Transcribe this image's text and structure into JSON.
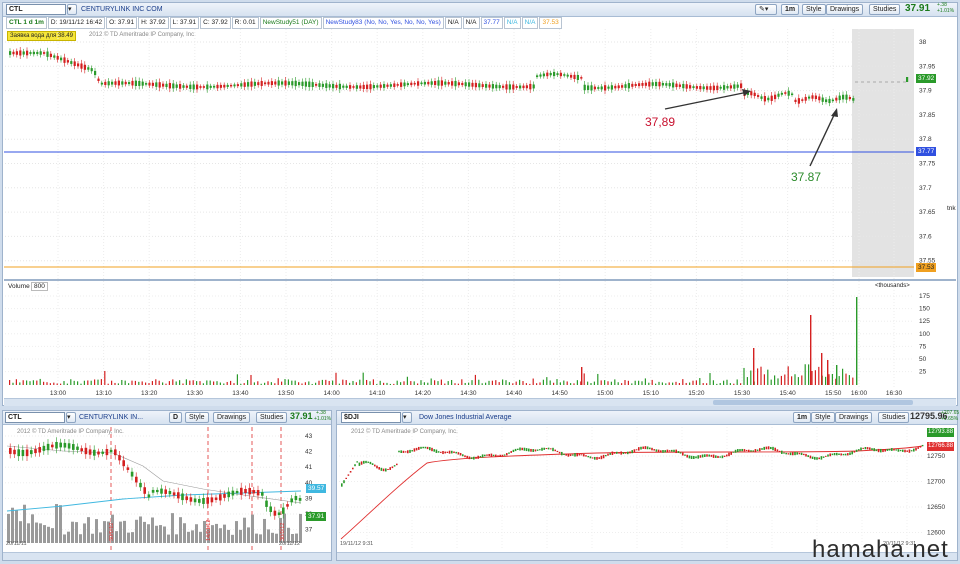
{
  "main_window": {
    "symbol": "CTL",
    "description": "CENTURYLINK INC COM",
    "toolbar": {
      "zoom": "1m",
      "style": "Style",
      "drawings": "Drawings",
      "studies": "Studies"
    },
    "last_price": "37.91",
    "change_line1": "+.38",
    "change_line2": "+1.01%",
    "info_chips": [
      "CTL 1 d 1m",
      "D: 19/11/12 16:42",
      "O: 37.91",
      "H: 37.92",
      "L: 37.91",
      "C: 37.92",
      "R: 0.01",
      "NewStudy51 (DAY)",
      "NewStudy83 (No, No, Yes, No, No, Yes)",
      "N/A",
      "N/A",
      "37.77",
      "N/A",
      "N/A",
      "37.53"
    ],
    "yellow_label": "Заявка вода для 38.49",
    "copyright": "2012 © TD Ameritrade IP Company, Inc.",
    "price_ticks": [
      "38",
      "37.95",
      "37.9",
      "37.85",
      "37.8",
      "37.75",
      "37.7",
      "37.65",
      "37.6",
      "37.55"
    ],
    "side_label": "tnk",
    "tag_last": "37.92",
    "tag_blue": "37.77",
    "tag_orange": "37.53",
    "annotation_left": "37,89",
    "annotation_right": "37.87",
    "volume_label": "Volume",
    "volume_value": "800",
    "volume_units": "<thousands>",
    "volume_ticks": [
      "175",
      "150",
      "125",
      "100",
      "75",
      "50",
      "25"
    ],
    "time_ticks": [
      "13:00",
      "13:10",
      "13:20",
      "13:30",
      "13:40",
      "13:50",
      "14:00",
      "14:10",
      "14:20",
      "14:30",
      "14:40",
      "14:50",
      "15:00",
      "15:10",
      "15:20",
      "15:30",
      "15:40",
      "15:50",
      "16:00",
      "16:30"
    ]
  },
  "bottom_left": {
    "symbol": "CTL",
    "description": "CENTURYLINK IN...",
    "aggregation": "D",
    "toolbar": {
      "style": "Style",
      "drawings": "Drawings",
      "studies": "Studies"
    },
    "last_price": "37.91",
    "change_line1": "+.38",
    "change_line2": "+1.01%",
    "copyright": "2012 © TD Ameritrade IP Company, Inc.",
    "price_ticks": [
      "43",
      "42",
      "41",
      "40",
      "39",
      "38",
      "37"
    ],
    "tag_blue": "39.57",
    "tag_last": "37.91",
    "date_left": "20/11/11",
    "date_right": "20/11/12",
    "event_labels": [
      "30/0/12",
      "14/01/12",
      "30/0/12"
    ]
  },
  "bottom_right": {
    "symbol": "$DJI",
    "description": "Dow Jones Industrial Average",
    "toolbar": {
      "zoom": "1m",
      "style": "Style",
      "drawings": "Drawings",
      "studies": "Studies"
    },
    "last_price": "12795.96",
    "change_line1": "+207.65",
    "change_line2": "+1.65%",
    "copyright": "2012 © TD Ameritrade IP Company, Inc.",
    "price_ticks": [
      "12750",
      "12700",
      "12650",
      "12600"
    ],
    "tag_green": "12793.88",
    "tag_red": "12766.88",
    "date_left": "19/11/12 9:31",
    "date_right": "20/11/12 9:31"
  },
  "watermark": "hamaha.net",
  "colors": {
    "up": "#2a9a2a",
    "down": "#d42020",
    "blue_line": "#3050e0",
    "orange_line": "#f0a020",
    "ma_red": "#e03030",
    "ma_cyan": "#40b8e0"
  }
}
